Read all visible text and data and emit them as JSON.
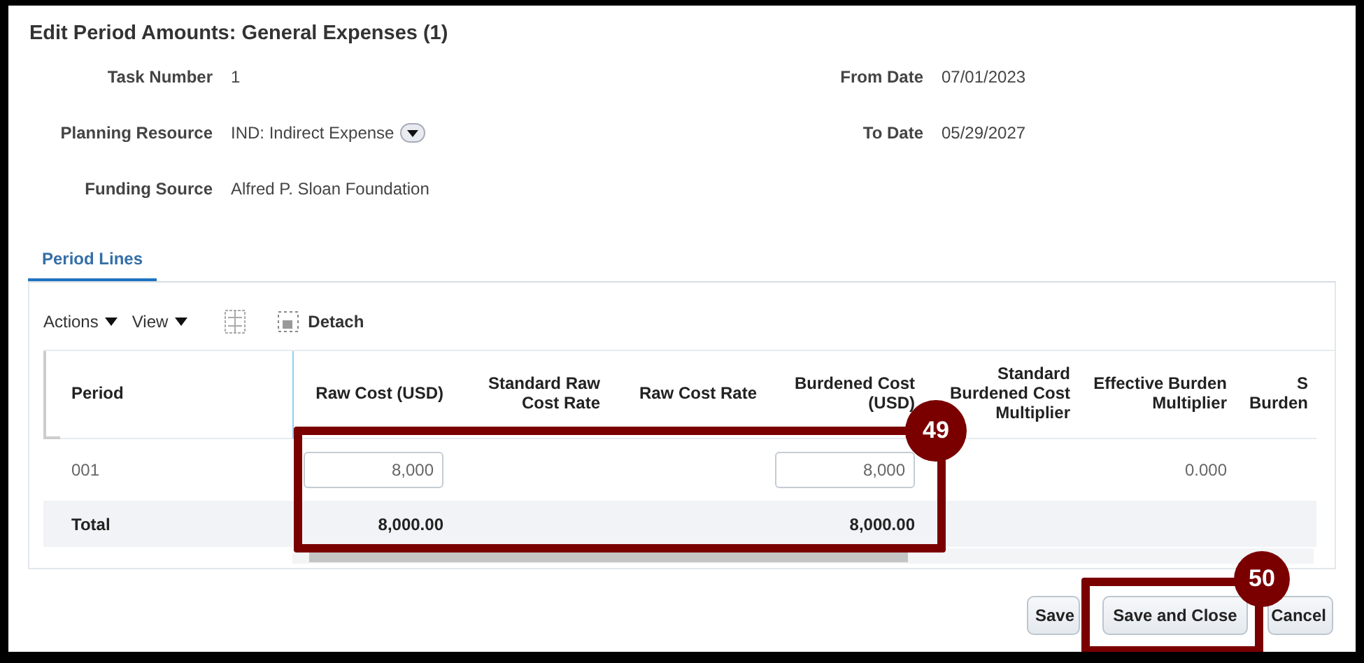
{
  "dialog": {
    "title": "Edit Period Amounts: General Expenses (1)"
  },
  "fields_left": [
    {
      "label": "Task Number",
      "value": "1",
      "kind": "text"
    },
    {
      "label": "Planning Resource",
      "value": "IND: Indirect Expense",
      "kind": "dropdown"
    },
    {
      "label": "Funding Source",
      "value": "Alfred P. Sloan Foundation",
      "kind": "text"
    }
  ],
  "fields_right": [
    {
      "label": "From Date",
      "value": "07/01/2023"
    },
    {
      "label": "To Date",
      "value": "05/29/2027"
    }
  ],
  "tabs": [
    {
      "label": "Period Lines",
      "selected": true
    }
  ],
  "toolbar": {
    "menus": [
      "Actions",
      "View"
    ],
    "detach": "Detach"
  },
  "table": {
    "columns": [
      "Period",
      "Raw Cost (USD)",
      "Standard Raw Cost Rate",
      "Raw Cost Rate",
      "Burdened Cost (USD)",
      "Standard Burdened Cost Multiplier",
      "Effective Burden Multiplier",
      "S Burden"
    ],
    "rows": [
      {
        "cells": [
          {
            "value": "001",
            "kind": "text"
          },
          {
            "value": "8,000",
            "kind": "input"
          },
          {
            "kind": "text"
          },
          {
            "kind": "text"
          },
          {
            "value": "8,000",
            "kind": "input"
          },
          {
            "kind": "text"
          },
          {
            "value": "0.000",
            "kind": "text"
          },
          {
            "kind": "text"
          }
        ]
      }
    ],
    "total": {
      "label": "Total",
      "values": [
        {
          "value": "8,000.00",
          "kind": "text"
        },
        {
          "kind": "text"
        },
        {
          "kind": "text"
        },
        {
          "value": "8,000.00",
          "kind": "text"
        },
        {
          "kind": "text"
        },
        {
          "kind": "text"
        },
        {
          "kind": "text"
        }
      ]
    }
  },
  "buttons": [
    {
      "label": "Save"
    },
    {
      "label": "Save and Close"
    },
    {
      "label": "Cancel"
    }
  ],
  "annotations": [
    {
      "number": "49"
    },
    {
      "number": "50"
    }
  ]
}
